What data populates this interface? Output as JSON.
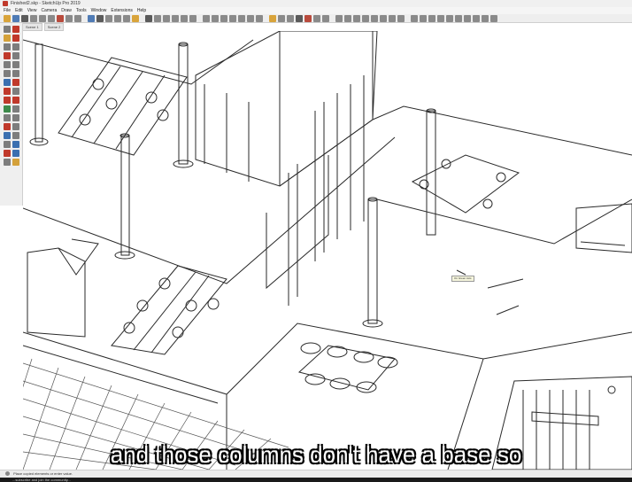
{
  "window": {
    "title": "Finished2.skp - SketchUp Pro 2019"
  },
  "menu": [
    "File",
    "Edit",
    "View",
    "Camera",
    "Draw",
    "Tools",
    "Window",
    "Extensions",
    "Help"
  ],
  "scenes": [
    "Scene 1",
    "Scene 2"
  ],
  "viewport": {
    "tooltip": "On Green Axis"
  },
  "caption": "and those columns don't have a base so",
  "status": {
    "message": "Place copied elements or enter value.",
    "footer": "...subscribe and join the community..."
  },
  "colors": {
    "linework": "#2a2a2a",
    "background": "#ffffff",
    "caption_text": "#ffffff"
  }
}
